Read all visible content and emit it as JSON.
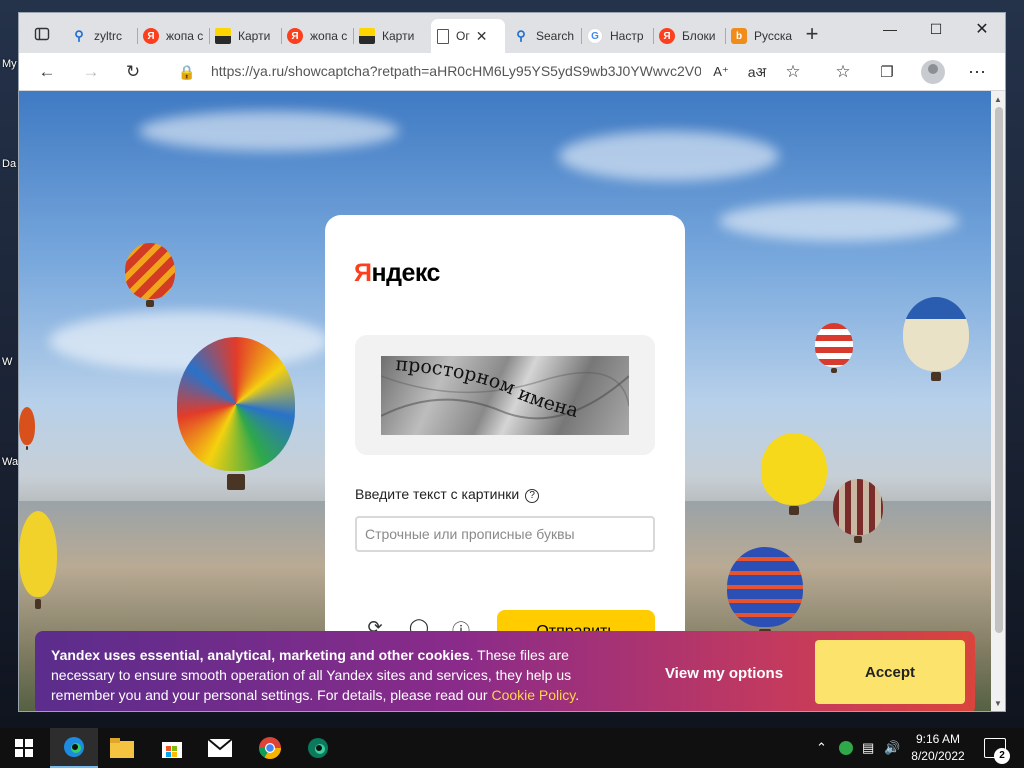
{
  "desktop": {
    "labels": [
      "My",
      "Da",
      "W",
      "Wa"
    ]
  },
  "browser": {
    "tabs": [
      {
        "label": "zyltrc",
        "icon": "search-icon"
      },
      {
        "label": "жопа с",
        "icon": "yandex-icon"
      },
      {
        "label": "Карти",
        "icon": "images-icon"
      },
      {
        "label": "жопа с",
        "icon": "yandex-icon"
      },
      {
        "label": "Карти",
        "icon": "images-icon"
      },
      {
        "label": "Ог",
        "icon": "document-icon",
        "active": true
      },
      {
        "label": "Search",
        "icon": "search-icon"
      },
      {
        "label": "Настр",
        "icon": "google-icon"
      },
      {
        "label": "Блоки",
        "icon": "yandex-icon"
      },
      {
        "label": "Русска",
        "icon": "site-icon"
      }
    ],
    "url": "https://ya.ru/showcaptcha?retpath=aHR0cHM6Ly95YS5ydS9wb3J0YWwvc2V0..."
  },
  "captcha": {
    "logo": "Яндекс",
    "image_text": "просторном имена",
    "label": "Введите текст с картинки",
    "input_placeholder": "Строчные или прописные буквы",
    "input_value": "",
    "submit_label": "Отправить"
  },
  "cookie": {
    "bold_text": "Yandex uses essential, analytical, marketing and other cookies",
    "text": ". These files are necessary to ensure smooth operation of all Yandex sites and services, they help us remember you and your personal settings. For details, please read our ",
    "link": "Cookie Policy",
    "period": ".",
    "options_label": "View my options",
    "accept_label": "Accept"
  },
  "taskbar": {
    "time": "9:16 AM",
    "date": "8/20/2022",
    "notification_count": "2"
  },
  "colors": {
    "yandex_red": "#fc3f1d",
    "submit_yellow": "#ffcc00",
    "accept_yellow": "#fce36b"
  }
}
